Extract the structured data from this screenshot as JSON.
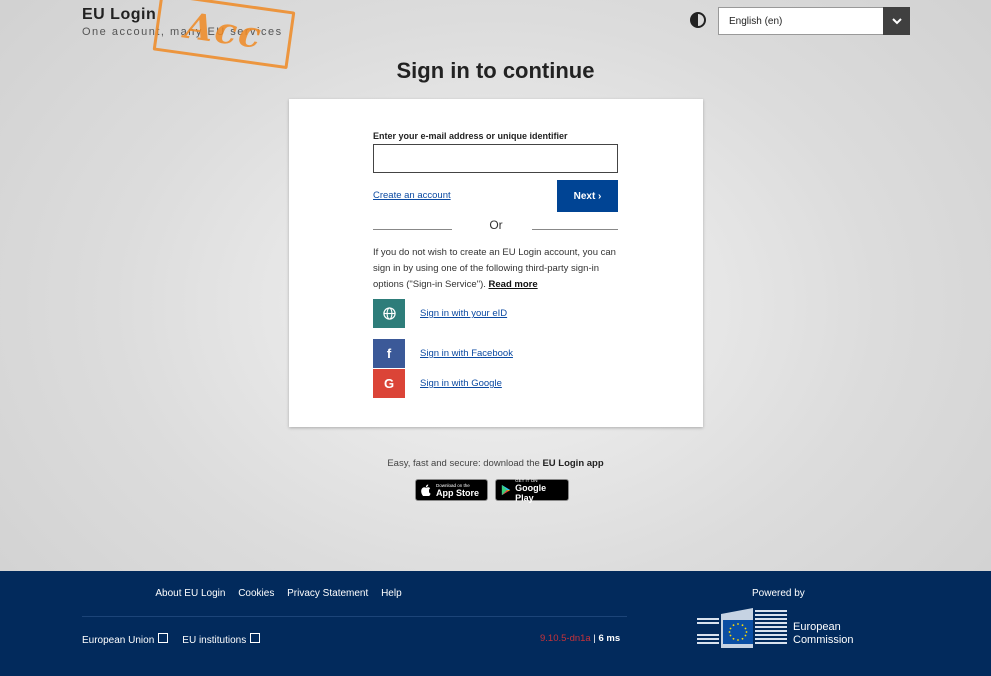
{
  "header": {
    "brand_title": "EU Login",
    "brand_subtitle": "One account, many EU services",
    "stamp_text": "Acc",
    "language": "English (en)"
  },
  "page_title": "Sign in to continue",
  "form": {
    "email_label": "Enter your e-mail address or unique identifier",
    "email_value": "",
    "email_placeholder": "",
    "create_account": "Create an account",
    "next_label": "Next ›",
    "or_label": "Or",
    "info_text": "If you do not wish to create an EU Login account, you can sign in by using one of the following third-party sign-in options (\"Sign-in Service\"). ",
    "read_more": "Read more"
  },
  "signin_options": [
    {
      "label": "Sign in with your eID",
      "icon": "globe-icon",
      "color": "#2e7d7a"
    },
    {
      "label": "Sign in with Facebook",
      "icon": "facebook-icon",
      "color": "#3b5998"
    },
    {
      "label": "Sign in with Google",
      "icon": "google-icon",
      "color": "#db4437"
    }
  ],
  "promo": {
    "text": "Easy, fast and secure: download the ",
    "app_name": "EU Login app",
    "app_store_small": "Download on the",
    "app_store_big": "App Store",
    "google_small": "GET IT ON",
    "google_big": "Google Play"
  },
  "footer": {
    "links": [
      "About EU Login",
      "Cookies",
      "Privacy Statement",
      "Help"
    ],
    "european_union": "European Union",
    "eu_institutions": "EU institutions",
    "version": "9.10.5-dn1a",
    "timing": "6 ms",
    "powered_by": "Powered by",
    "ec_line1": "European",
    "ec_line2": "Commission",
    "footer_color": "#022a5c"
  }
}
